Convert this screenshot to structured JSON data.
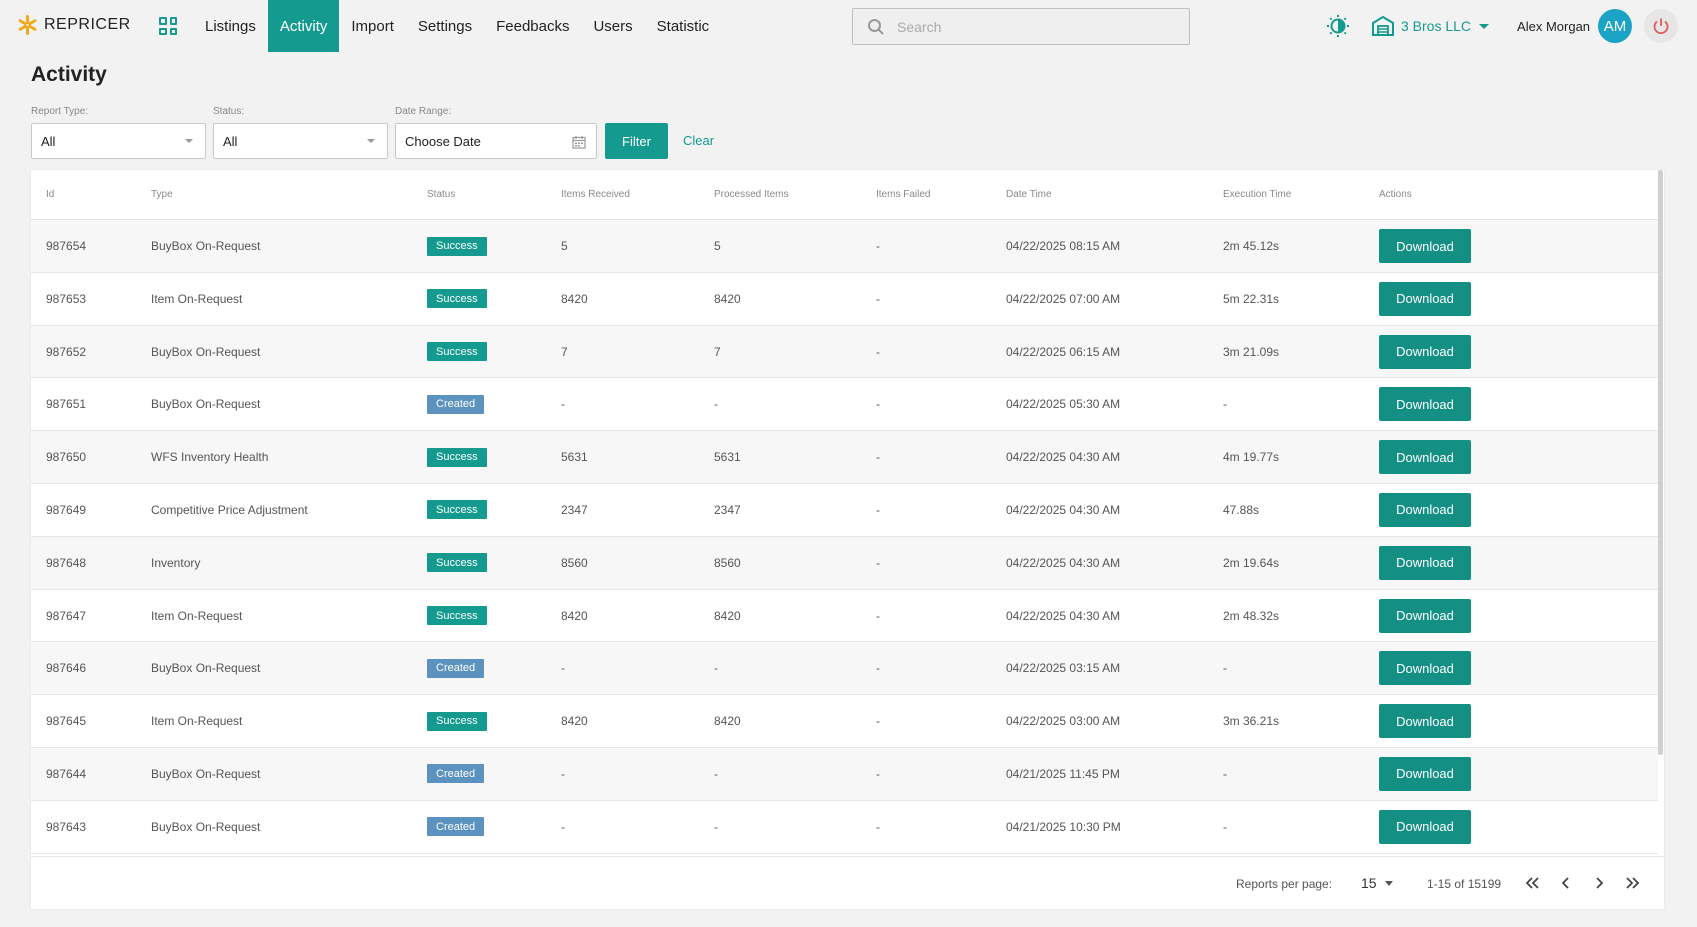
{
  "app": {
    "name": "REPRICER"
  },
  "nav": {
    "items": [
      "Listings",
      "Activity",
      "Import",
      "Settings",
      "Feedbacks",
      "Users",
      "Statistic"
    ],
    "active": "Activity"
  },
  "search": {
    "placeholder": "Search",
    "value": ""
  },
  "company": {
    "name": "3 Bros LLC"
  },
  "user": {
    "name": "Alex Morgan",
    "initials": "AM"
  },
  "page": {
    "title": "Activity"
  },
  "filters": {
    "report_type": {
      "label": "Report Type:",
      "value": "All"
    },
    "status": {
      "label": "Status:",
      "value": "All"
    },
    "date_range": {
      "label": "Date Range:",
      "placeholder": "Choose Date"
    },
    "filter_label": "Filter",
    "clear_label": "Clear"
  },
  "table": {
    "columns": [
      "Id",
      "Type",
      "Status",
      "Items Received",
      "Processed Items",
      "Items Failed",
      "Date Time",
      "Execution Time",
      "Actions"
    ],
    "action_label": "Download",
    "rows": [
      [
        "987654",
        "BuyBox On-Request",
        "Success",
        "5",
        "5",
        "-",
        "04/22/2025 08:15 AM",
        "2m 45.12s"
      ],
      [
        "987653",
        "Item On-Request",
        "Success",
        "8420",
        "8420",
        "-",
        "04/22/2025 07:00 AM",
        "5m 22.31s"
      ],
      [
        "987652",
        "BuyBox On-Request",
        "Success",
        "7",
        "7",
        "-",
        "04/22/2025 06:15 AM",
        "3m 21.09s"
      ],
      [
        "987651",
        "BuyBox On-Request",
        "Created",
        "-",
        "-",
        "-",
        "04/22/2025 05:30 AM",
        "-"
      ],
      [
        "987650",
        "WFS Inventory Health",
        "Success",
        "5631",
        "5631",
        "-",
        "04/22/2025 04:30 AM",
        "4m 19.77s"
      ],
      [
        "987649",
        "Competitive Price Adjustment",
        "Success",
        "2347",
        "2347",
        "-",
        "04/22/2025 04:30 AM",
        "47.88s"
      ],
      [
        "987648",
        "Inventory",
        "Success",
        "8560",
        "8560",
        "-",
        "04/22/2025 04:30 AM",
        "2m 19.64s"
      ],
      [
        "987647",
        "Item On-Request",
        "Success",
        "8420",
        "8420",
        "-",
        "04/22/2025 04:30 AM",
        "2m 48.32s"
      ],
      [
        "987646",
        "BuyBox On-Request",
        "Created",
        "-",
        "-",
        "-",
        "04/22/2025 03:15 AM",
        "-"
      ],
      [
        "987645",
        "Item On-Request",
        "Success",
        "8420",
        "8420",
        "-",
        "04/22/2025 03:00 AM",
        "3m 36.21s"
      ],
      [
        "987644",
        "BuyBox On-Request",
        "Created",
        "-",
        "-",
        "-",
        "04/21/2025 11:45 PM",
        "-"
      ],
      [
        "987643",
        "BuyBox On-Request",
        "Created",
        "-",
        "-",
        "-",
        "04/21/2025 10:30 PM",
        "-"
      ]
    ]
  },
  "pagination": {
    "per_page_label": "Reports per page:",
    "per_page": "15",
    "range": "1-15 of 15199"
  },
  "colors": {
    "accent": "#159a8f",
    "created": "#5b92c0",
    "avatar": "#1ba3c6"
  },
  "icons": [
    "logo-icon",
    "apps-grid-icon",
    "search-icon",
    "theme-toggle-icon",
    "store-icon",
    "power-icon",
    "calendar-icon",
    "first-page-icon",
    "prev-page-icon",
    "next-page-icon",
    "last-page-icon"
  ]
}
